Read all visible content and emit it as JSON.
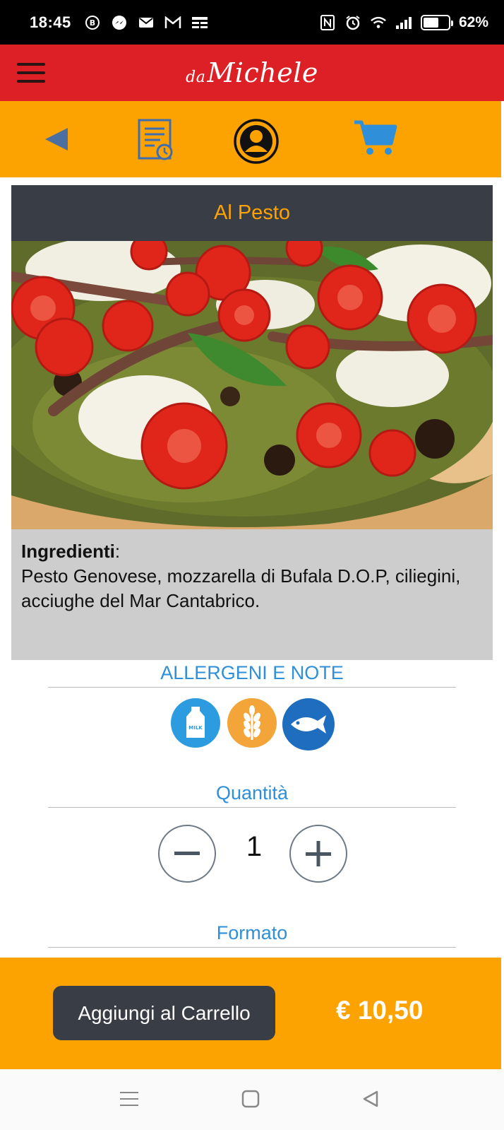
{
  "status_bar": {
    "time": "18:45",
    "battery_percent": "62%",
    "battery_level": 0.62
  },
  "header": {
    "logo_prefix": "da",
    "logo_name": "Michele"
  },
  "product": {
    "title": "Al Pesto",
    "ingredients_label": "Ingredienti",
    "ingredients_separator": ":",
    "ingredients_text": "Pesto Genovese, mozzarella di Bufala D.O.P, ciliegini, acciughe del Mar Cantabrico."
  },
  "allergens": {
    "heading": "ALLERGENI E NOTE",
    "milk_label": "MILK",
    "items": [
      "milk-icon",
      "gluten-icon",
      "fish-icon"
    ],
    "colors": [
      "#2c9be0",
      "#f4a53a",
      "#1e6dbf"
    ]
  },
  "quantity": {
    "heading": "Quantità",
    "value": "1"
  },
  "format": {
    "heading": "Formato"
  },
  "cart": {
    "add_label": "Aggiungi al Carrello",
    "price": "€ 10,50"
  },
  "colors": {
    "header_red": "#dd2025",
    "accent_orange": "#fda301",
    "dark": "#393d45",
    "link_blue": "#2f8fd8"
  }
}
